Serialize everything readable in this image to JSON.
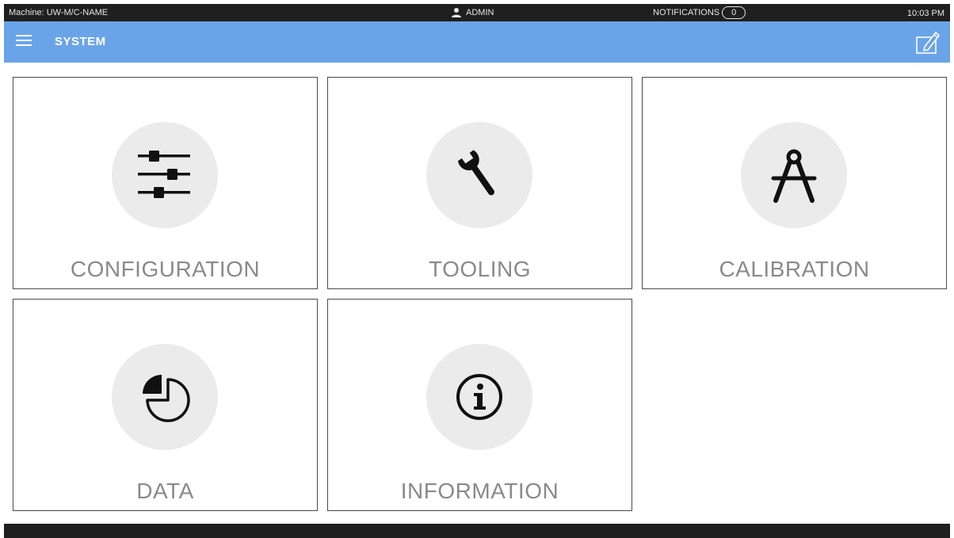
{
  "status_bar": {
    "machine": "Machine: UW-M/C-NAME",
    "user": "ADMIN",
    "notifications_label": "NOTIFICATIONS",
    "notifications_count": "0",
    "time": "10:03 PM"
  },
  "header": {
    "title": "SYSTEM",
    "menu_icon": "hamburger-menu-icon",
    "edit_icon": "edit-note-icon",
    "accent_color": "#6aa4e8"
  },
  "tiles": [
    {
      "label": "CONFIGURATION",
      "icon": "sliders-icon"
    },
    {
      "label": "TOOLING",
      "icon": "wrench-icon"
    },
    {
      "label": "CALIBRATION",
      "icon": "compass-icon"
    },
    {
      "label": "DATA",
      "icon": "pie-chart-icon"
    },
    {
      "label": "INFORMATION",
      "icon": "info-icon"
    }
  ]
}
